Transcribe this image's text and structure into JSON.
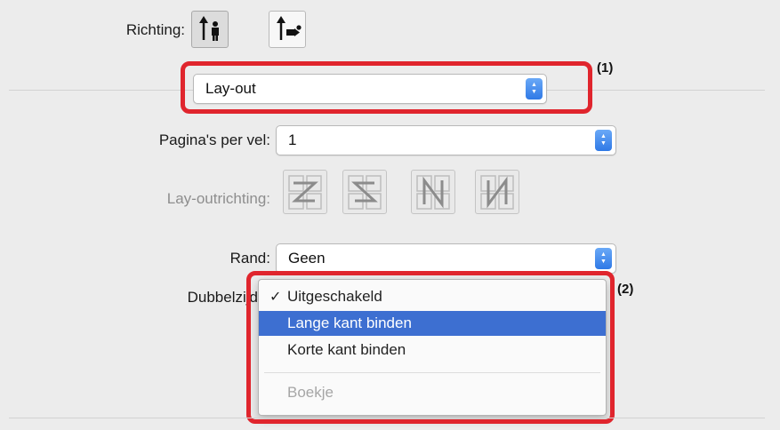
{
  "orientation": {
    "label": "Richting:",
    "options": [
      "portrait",
      "landscape"
    ],
    "selected": "portrait"
  },
  "panel_select": {
    "value": "Lay-out"
  },
  "pages_per_sheet": {
    "label": "Pagina's per vel:",
    "value": "1"
  },
  "layout_direction": {
    "label": "Lay-outrichting:",
    "enabled": false,
    "options": [
      "z-order",
      "reverse-z-order",
      "n-order",
      "reverse-n-order"
    ]
  },
  "border": {
    "label": "Rand:",
    "value": "Geen"
  },
  "duplex": {
    "label": "Dubbelzijd",
    "menu": [
      {
        "label": "Uitgeschakeld",
        "checked": true,
        "highlighted": false,
        "enabled": true
      },
      {
        "label": "Lange kant binden",
        "checked": false,
        "highlighted": true,
        "enabled": true
      },
      {
        "label": "Korte kant binden",
        "checked": false,
        "highlighted": false,
        "enabled": true
      },
      {
        "label": "Boekje",
        "checked": false,
        "highlighted": false,
        "enabled": false
      }
    ]
  },
  "callouts": {
    "first": "(1)",
    "second": "(2)"
  },
  "colors": {
    "frame": "#e0252d",
    "highlight": "#3d6fd1",
    "stepper": "#2f79e6"
  }
}
